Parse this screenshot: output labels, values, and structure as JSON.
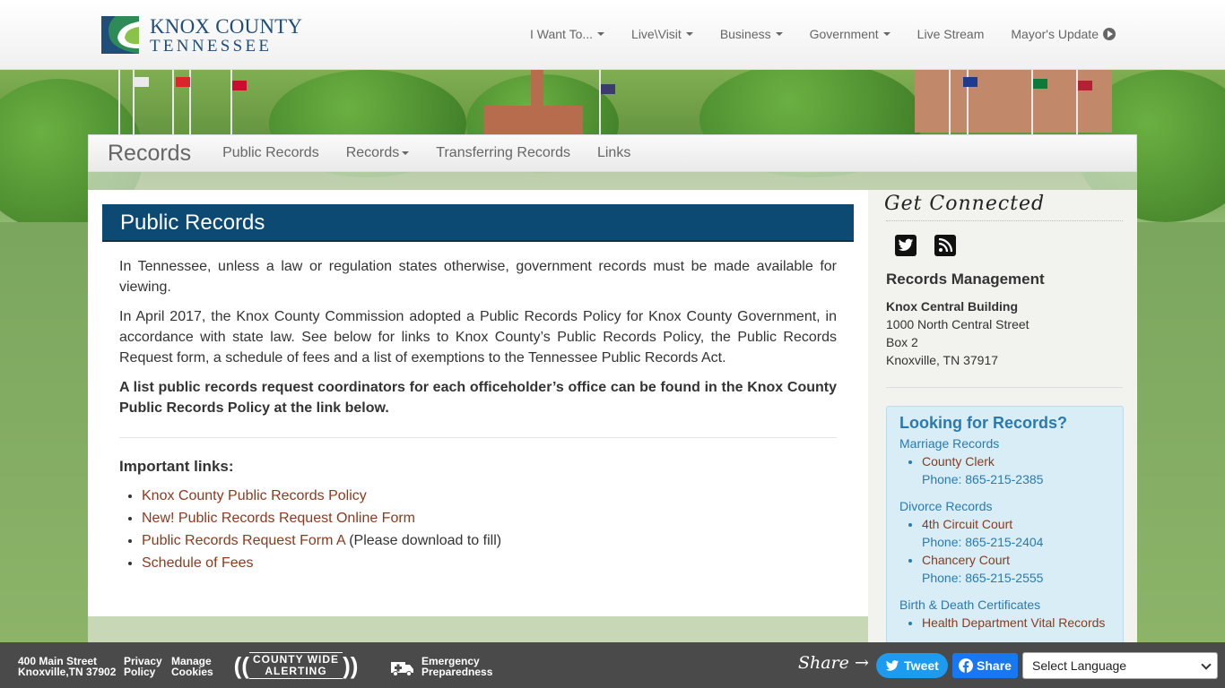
{
  "header": {
    "logo": {
      "line1": "KNOX COUNTY",
      "line2": "TENNESSEE"
    },
    "nav": [
      {
        "label": "I Want To...",
        "dropdown": true
      },
      {
        "label": "Live\\Visit",
        "dropdown": true
      },
      {
        "label": "Business",
        "dropdown": true
      },
      {
        "label": "Government",
        "dropdown": true
      },
      {
        "label": "Live Stream",
        "dropdown": false
      },
      {
        "label": "Mayor's Update",
        "dropdown": false
      }
    ]
  },
  "subnav": {
    "brand": "Records",
    "items": [
      {
        "label": "Public Records"
      },
      {
        "label": "Records",
        "dropdown": true
      },
      {
        "label": "Transferring Records"
      },
      {
        "label": "Links"
      }
    ]
  },
  "main": {
    "title": "Public Records",
    "paragraphs": [
      "In Tennessee, unless a law or regulation states otherwise, government records must be made available for viewing.",
      "In April 2017, the Knox County Commission adopted a Public Records Policy for Knox County Government, in accordance with state law. See below for links to Knox County’s Public Records Policy, the Public Records Request form, a schedule of fees and a list of exemptions to the Tennessee Public Records Act."
    ],
    "bold_paragraph": "A list public records request coordinators for each officeholder’s office can be found in the Knox County Public Records Policy at the link below.",
    "links_heading": "Important links:",
    "links": [
      {
        "label": "Knox County Public Records Policy",
        "suffix": ""
      },
      {
        "label": "New! Public Records Request Online Form",
        "suffix": ""
      },
      {
        "label": "Public Records Request Form A",
        "suffix": " (Please download to fill)"
      },
      {
        "label": "Schedule of Fees",
        "suffix": ""
      }
    ]
  },
  "sidebar": {
    "get_connected": "Get Connected",
    "social": [
      {
        "icon": "twitter-icon"
      },
      {
        "icon": "rss-icon"
      }
    ],
    "dept_title": "Records Management",
    "address": {
      "building": "Knox Central Building",
      "street": "1000 North Central Street",
      "box": "Box 2",
      "city": "Knoxville, TN 37917"
    },
    "looking": {
      "title": "Looking for Records?",
      "groups": [
        {
          "category": "Marriage Records",
          "items": [
            {
              "name": "County Clerk",
              "phone": "Phone: 865-215-2385"
            }
          ]
        },
        {
          "category": "Divorce Records",
          "items": [
            {
              "name": "4th Circuit Court",
              "phone": "Phone: 865-215-2404"
            },
            {
              "name": "Chancery Court",
              "phone": "Phone: 865-215-2555"
            }
          ]
        },
        {
          "category": "Birth & Death Certificates",
          "items": [
            {
              "name": "Health Department Vital Records",
              "phone": ""
            }
          ]
        }
      ]
    }
  },
  "footer": {
    "address_line1": "400 Main Street",
    "address_line2": "Knoxville,TN 37902",
    "privacy": [
      "Privacy",
      "Policy"
    ],
    "cookies": [
      "Manage",
      "Cookies"
    ],
    "alerting": [
      "COUNTY WIDE",
      "ALERTING"
    ],
    "emergency": [
      "Emergency",
      "Preparedness"
    ],
    "share_label": "Share",
    "tweet": "Tweet",
    "fb_share": "Share",
    "language": "Select Language"
  },
  "colors": {
    "title_bar": "#0d4a73",
    "link": "#8b3a1e",
    "sidebar_blue": "#2a7ab0",
    "footer": "#4a4a4a",
    "tweet": "#1d9bf0",
    "facebook": "#1877f2"
  }
}
